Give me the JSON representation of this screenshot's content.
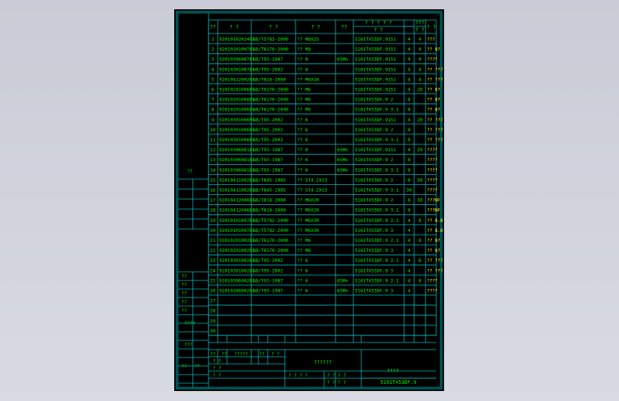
{
  "header": {
    "seq": "??",
    "code": "?  ?",
    "standard": "?    ?",
    "name": "?   ?",
    "material": "??",
    "assembly_top": "? ? ? ? ?",
    "assembly_sub": "?   ?",
    "qty_top": "???",
    "qty_sub": "? ?",
    "remark": "?  ?"
  },
  "rows": [
    {
      "no": "1",
      "code": "9201010202402",
      "std": "GB/T5783-2000",
      "name": "?? M8X25",
      "mat": "",
      "asm": "5161TX53DF.9151",
      "q1": "4",
      "q2": "4",
      "rm": "???"
    },
    {
      "no": "2",
      "code": "9201020100781",
      "std": "GB/T6170-2000",
      "name": "?? M8",
      "mat": "",
      "asm": "5161TX53DF.9151",
      "q1": "4",
      "q2": "4",
      "rm": "?? 8?"
    },
    {
      "no": "3",
      "code": "9201030608781",
      "std": "GB/T93-1987",
      "name": "?? 8",
      "mat": "65Mn",
      "asm": "5161TX53DF.9151",
      "q1": "4",
      "q2": "4",
      "rm": "????"
    },
    {
      "no": "4",
      "code": "9201030100781",
      "std": "GB/T95-2002",
      "name": "?? 8",
      "mat": "",
      "asm": "5161TX53DF.9151",
      "q1": "4",
      "q2": "4",
      "rm": "?? ???"
    },
    {
      "no": "5",
      "code": "9201041200281",
      "std": "GB/T818-2000",
      "name": "?? M6X16",
      "mat": "",
      "asm": "5161TX53DF.9151",
      "q1": "4",
      "q2": "4",
      "rm": "?? ???"
    },
    {
      "no": "6",
      "code": "9201020100601",
      "std": "GB/T6170-2000",
      "name": "?? M6",
      "mat": "",
      "asm": "5161TX53DF.9151",
      "q1": "4",
      "q2": "20",
      "rm": "?? 8?"
    },
    {
      "no": "7",
      "code": "9201020100601",
      "std": "GB/T6170-2000",
      "name": "?? M6",
      "mat": "",
      "asm": "5161TX53DF.9 2",
      "q1": "8",
      "q2": "",
      "rm": "?? 8?"
    },
    {
      "no": "8",
      "code": "9201020100601",
      "std": "GB/T6170-2000",
      "name": "?? M6",
      "mat": "",
      "asm": "5161TX53DF.9 3.1",
      "q1": "8",
      "q2": "",
      "rm": "?? 8?"
    },
    {
      "no": "9",
      "code": "9201030100601",
      "std": "GB/T95-2002",
      "name": "?? 6",
      "mat": "",
      "asm": "5161TX53DF.9151",
      "q1": "4",
      "q2": "20",
      "rm": "?? ???"
    },
    {
      "no": "10",
      "code": "9201030100601",
      "std": "GB/T95-2002",
      "name": "?? 6",
      "mat": "",
      "asm": "5161TX53DF.9 2",
      "q1": "8",
      "q2": "",
      "rm": "?? ???"
    },
    {
      "no": "11",
      "code": "9201030100601",
      "std": "GB/T95-2002",
      "name": "?? 6",
      "mat": "",
      "asm": "5161TX53DF.9 3.1",
      "q1": "8",
      "q2": "",
      "rm": "?? ???"
    },
    {
      "no": "12",
      "code": "9201030608181",
      "std": "GB/T93-1987",
      "name": "?? 6",
      "mat": "65Mn",
      "asm": "5161TX53DF.9151",
      "q1": "4",
      "q2": "20",
      "rm": "????"
    },
    {
      "no": "13",
      "code": "9201030608181",
      "std": "GB/T93-1987",
      "name": "?? 6",
      "mat": "65Mn",
      "asm": "5161TX53DF.9 2",
      "q1": "8",
      "q2": "",
      "rm": "????"
    },
    {
      "no": "14",
      "code": "9201030608181",
      "std": "GB/T93-1987",
      "name": "?? 6",
      "mat": "65Mn",
      "asm": "5161TX53DF.9 3.1",
      "q1": "8",
      "q2": "",
      "rm": "????"
    },
    {
      "no": "15",
      "code": "9201041100281",
      "std": "GB/T845-1985",
      "name": "?? ST4.2X13",
      "mat": "",
      "asm": "5161TX53DF.9 2",
      "q1": "8",
      "q2": "30",
      "rm": "????"
    },
    {
      "no": "16",
      "code": "9201041100281",
      "std": "GB/T845-1985",
      "name": "?? ST4.2X13",
      "mat": "",
      "asm": "5161TX53DF.9 3.1",
      "q1": "30",
      "q2": "",
      "rm": "????"
    },
    {
      "no": "17",
      "code": "9201041200681",
      "std": "GB/T818-2000",
      "name": "?? M6X20",
      "mat": "",
      "asm": "5161TX53DF.9 2",
      "q1": "8",
      "q2": "16",
      "rm": "???NF"
    },
    {
      "no": "18",
      "code": "9201041200681",
      "std": "GB/T818-2000",
      "name": "?? M6X20",
      "mat": "",
      "asm": "5161TX53DF.9 3.1",
      "q1": "8",
      "q2": "",
      "rm": "???NF"
    },
    {
      "no": "19",
      "code": "9201010100701",
      "std": "GB/T5782-2000",
      "name": "?? M6X30",
      "mat": "",
      "asm": "5161TX53DF.9 2.1",
      "q1": "4",
      "q2": "8",
      "rm": "?? 8.8?"
    },
    {
      "no": "20",
      "code": "9201010100701",
      "std": "GB/T5782-2000",
      "name": "?? M6X30",
      "mat": "",
      "asm": "5161TX53DF.9 3",
      "q1": "4",
      "q2": "",
      "rm": "?? 8.8?"
    },
    {
      "no": "21",
      "code": "9201020100281",
      "std": "GB/T6170-2000",
      "name": "?? M6",
      "mat": "",
      "asm": "5161TX53DF.9 2.1",
      "q1": "4",
      "q2": "8",
      "rm": "?? 8?"
    },
    {
      "no": "22",
      "code": "9201020100281",
      "std": "GB/T6170-2000",
      "name": "?? M6",
      "mat": "",
      "asm": "5161TX53DF.9 3",
      "q1": "4",
      "q2": "",
      "rm": "?? 8?"
    },
    {
      "no": "23",
      "code": "9201030100281",
      "std": "GB/T95-2002",
      "name": "?? 6",
      "mat": "",
      "asm": "5161TX53DF.9 2.1",
      "q1": "4",
      "q2": "8",
      "rm": "?? ???"
    },
    {
      "no": "24",
      "code": "9201030100281",
      "std": "GB/T95-2002",
      "name": "?? 6",
      "mat": "",
      "asm": "5161TX53DF.9 3",
      "q1": "4",
      "q2": "",
      "rm": "?? ???"
    },
    {
      "no": "25",
      "code": "9201030600281",
      "std": "GB/T93-1987",
      "name": "?? 6",
      "mat": "65Mn",
      "asm": "5161TX53DF.9 2.1",
      "q1": "4",
      "q2": "8",
      "rm": "????"
    },
    {
      "no": "26",
      "code": "9201030600281",
      "std": "GB/T93-1987",
      "name": "?? 6",
      "mat": "65Mn",
      "asm": "5161TX53DF.9 3",
      "q1": "4",
      "q2": "",
      "rm": "????"
    },
    {
      "no": "27",
      "code": "",
      "std": "",
      "name": "",
      "mat": "",
      "asm": "",
      "q1": "",
      "q2": "",
      "rm": ""
    },
    {
      "no": "28",
      "code": "",
      "std": "",
      "name": "",
      "mat": "",
      "asm": "",
      "q1": "",
      "q2": "",
      "rm": ""
    },
    {
      "no": "29",
      "code": "",
      "std": "",
      "name": "",
      "mat": "",
      "asm": "",
      "q1": "",
      "q2": "",
      "rm": ""
    },
    {
      "no": "30",
      "code": "",
      "std": "",
      "name": "",
      "mat": "",
      "asm": "",
      "q1": "",
      "q2": "",
      "rm": ""
    }
  ],
  "left_panel": {
    "side_mark": "??",
    "labels": [
      "??",
      "??",
      "??",
      "??",
      "??"
    ],
    "label_a": "????",
    "label_b": "???",
    "label_c": "??",
    "label_d": "??"
  },
  "title_block": {
    "title": "??????",
    "sub_title": "????",
    "drawing_no": "5161TX53DF.9",
    "r1": [
      "??",
      "??",
      "?????",
      "??",
      "? ?"
    ],
    "r2": [
      "? ?",
      "? ?"
    ],
    "r3": [
      "? ?",
      "? ? ? ?",
      "? ?",
      "? ?"
    ],
    "r4": [
      "? ?",
      "? ?",
      "? ?"
    ]
  },
  "colors": {
    "background": "#000000",
    "frame": "#00c6c6",
    "text": "#00ff00",
    "accent": "#ffff00"
  }
}
